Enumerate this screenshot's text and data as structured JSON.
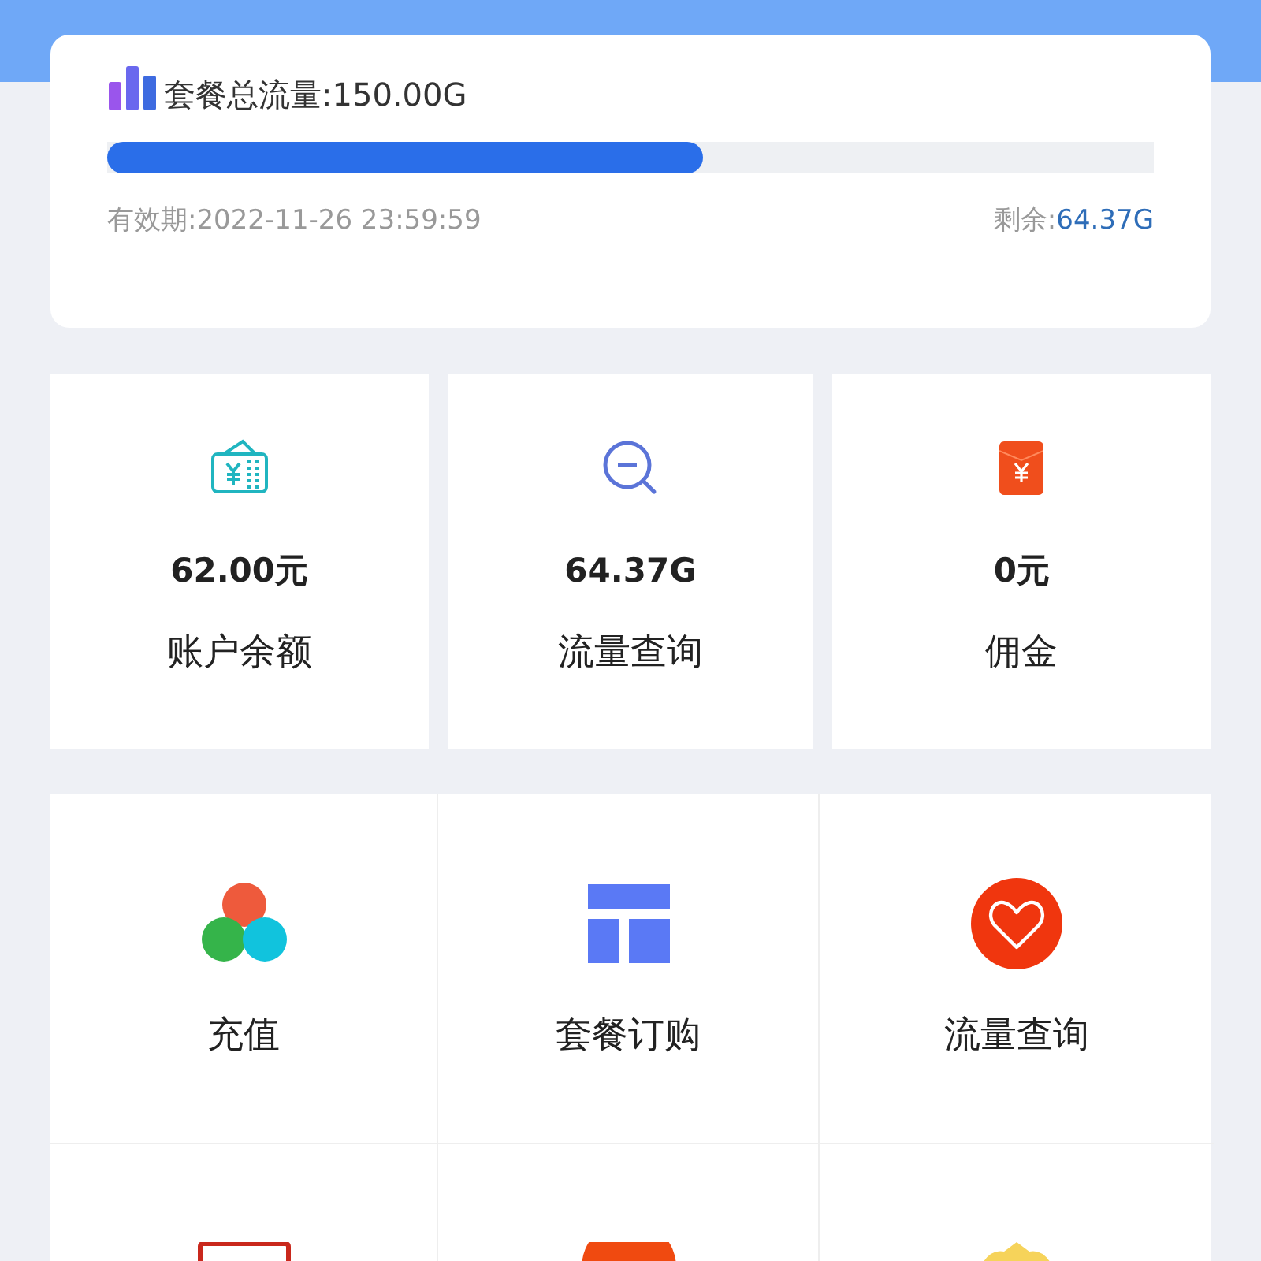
{
  "plan": {
    "title": "套餐总流量:",
    "total": "150.00G",
    "level": 0.57,
    "validity_label": "有效期:",
    "validity": "2022-11-26 23:59:59",
    "remaining_label": "剩余:",
    "remaining": "64.37G"
  },
  "stats": [
    {
      "value": "62.00元",
      "label": "账户余额"
    },
    {
      "value": "64.37G",
      "label": "流量查询"
    },
    {
      "value": "0元",
      "label": "佣金"
    }
  ],
  "menu": [
    {
      "label": "充值"
    },
    {
      "label": "套餐订购"
    },
    {
      "label": "流量查询"
    }
  ]
}
